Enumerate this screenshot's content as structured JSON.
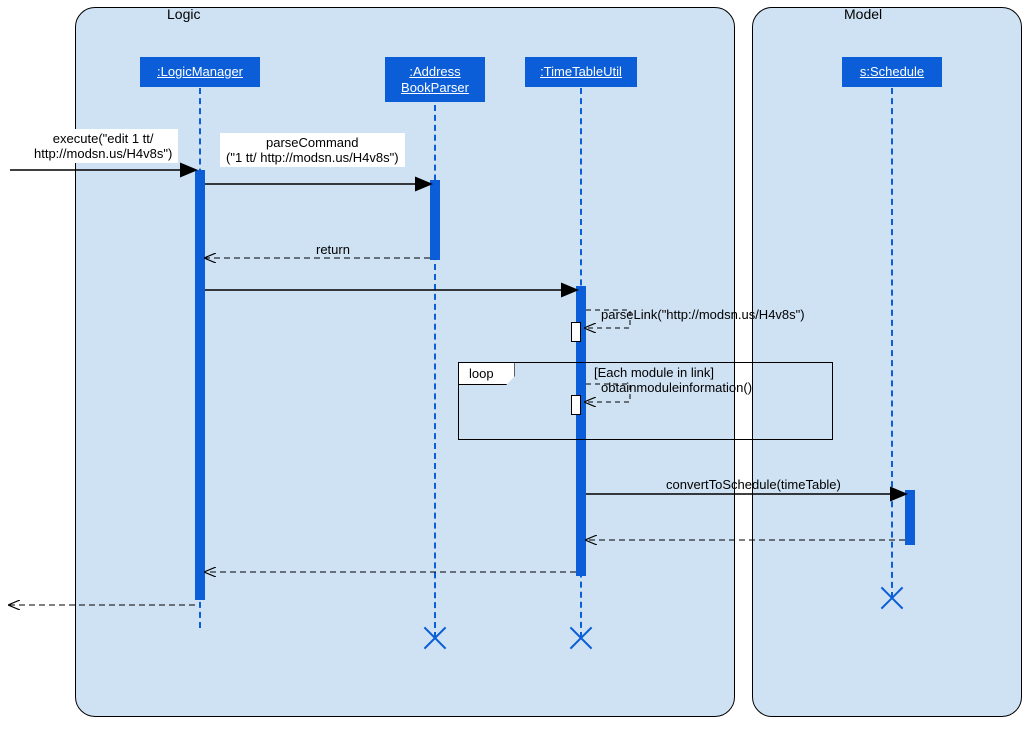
{
  "regions": {
    "logic": {
      "label": "Logic"
    },
    "model": {
      "label": "Model"
    }
  },
  "lifelines": {
    "logicManager": ":LogicManager",
    "addressBookParser": ":Address\nBookParser",
    "timeTableUtil": ":TimeTableUtil",
    "schedule": "s:Schedule"
  },
  "messages": {
    "execute": "execute(\"edit 1 tt/\nhttp://modsn.us/H4v8s\")",
    "parseCommand": "parseCommand\n(\"1 tt/ http://modsn.us/H4v8s\")",
    "return": "return",
    "parseLink": "parseLink(\"http://modsn.us/H4v8s\")",
    "obtainModule": "obtainmoduleinformation()",
    "convertSchedule": "convertToSchedule(timeTable)"
  },
  "loop": {
    "tag": "loop",
    "guard": "[Each module in link]"
  },
  "colors": {
    "region": "#cfe2f3",
    "primary": "#0b5ed7"
  }
}
